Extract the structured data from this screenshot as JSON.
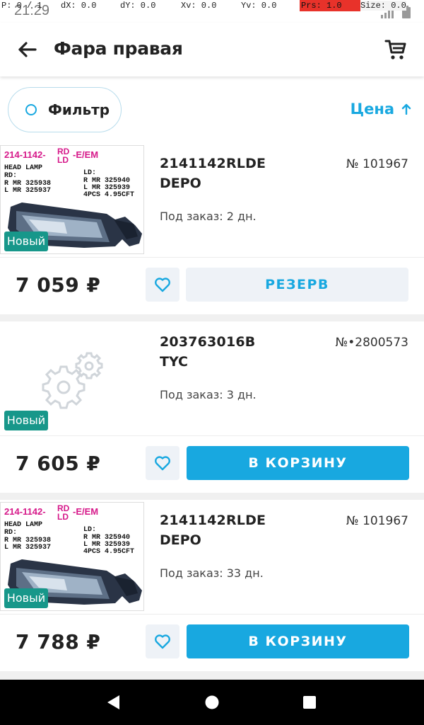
{
  "status_bar": {
    "time": "21:29"
  },
  "debug_overlay": {
    "p": "P: 0 / 1",
    "dx": "dX: 0.0",
    "dy": "dY: 0.0",
    "xv": "Xv: 0.0",
    "yv": "Yv: 0.0",
    "prs": "Prs: 1.0",
    "size": "Size: 0.0"
  },
  "header": {
    "title": "Фара правая",
    "back_icon": "arrow-left-icon",
    "cart_icon": "cart-icon"
  },
  "filter": {
    "label": "Фильтр",
    "sort_label": "Цена",
    "sort_icon": "arrow-up-icon"
  },
  "colors": {
    "accent": "#18a8e0",
    "badge": "#17978a",
    "secondary_bg": "#eef2f7"
  },
  "products": [
    {
      "sku": "2141142RLDE",
      "brand": "DEPO",
      "number": "№ 101967",
      "delivery": "Под заказ: 2 дн.",
      "badge": "Новый",
      "price": "7 059 ₽",
      "action": "РЕЗЕРВ",
      "image": {
        "line1a": "214-1142-",
        "rd": "RD",
        "ld": "LD",
        "line1b": "-E/EM",
        "head": "HEAD  LAMP",
        "rd_label": "RD:",
        "rd_r": "R  MR  325938",
        "rd_l": "L  MR  325937",
        "ld_label": "LD:",
        "ld_r": "R  MR  325940",
        "ld_l": "L  MR  325939",
        "pcs": "4PCS  4.95CFT"
      }
    },
    {
      "sku": "203763016B",
      "brand": "TYC",
      "number": "№•2800573",
      "delivery": "Под заказ: 3 дн.",
      "badge": "Новый",
      "price": "7 605 ₽",
      "action": "В КОРЗИНУ",
      "image_icon": "gears-placeholder-icon"
    },
    {
      "sku": "2141142RLDE",
      "brand": "DEPO",
      "number": "№ 101967",
      "delivery": "Под заказ: 33 дн.",
      "badge": "Новый",
      "price": "7 788 ₽",
      "action": "В КОРЗИНУ",
      "image": {
        "line1a": "214-1142-",
        "rd": "RD",
        "ld": "LD",
        "line1b": "-E/EM",
        "head": "HEAD  LAMP",
        "rd_label": "RD:",
        "rd_r": "R  MR  325938",
        "rd_l": "L  MR  325937",
        "ld_label": "LD:",
        "ld_r": "R  MR  325940",
        "ld_l": "L  MR  325939",
        "pcs": "4PCS  4.95CFT"
      }
    }
  ],
  "nav": {
    "back_icon": "triangle-back-icon",
    "home_icon": "circle-home-icon",
    "recents_icon": "square-recents-icon"
  }
}
